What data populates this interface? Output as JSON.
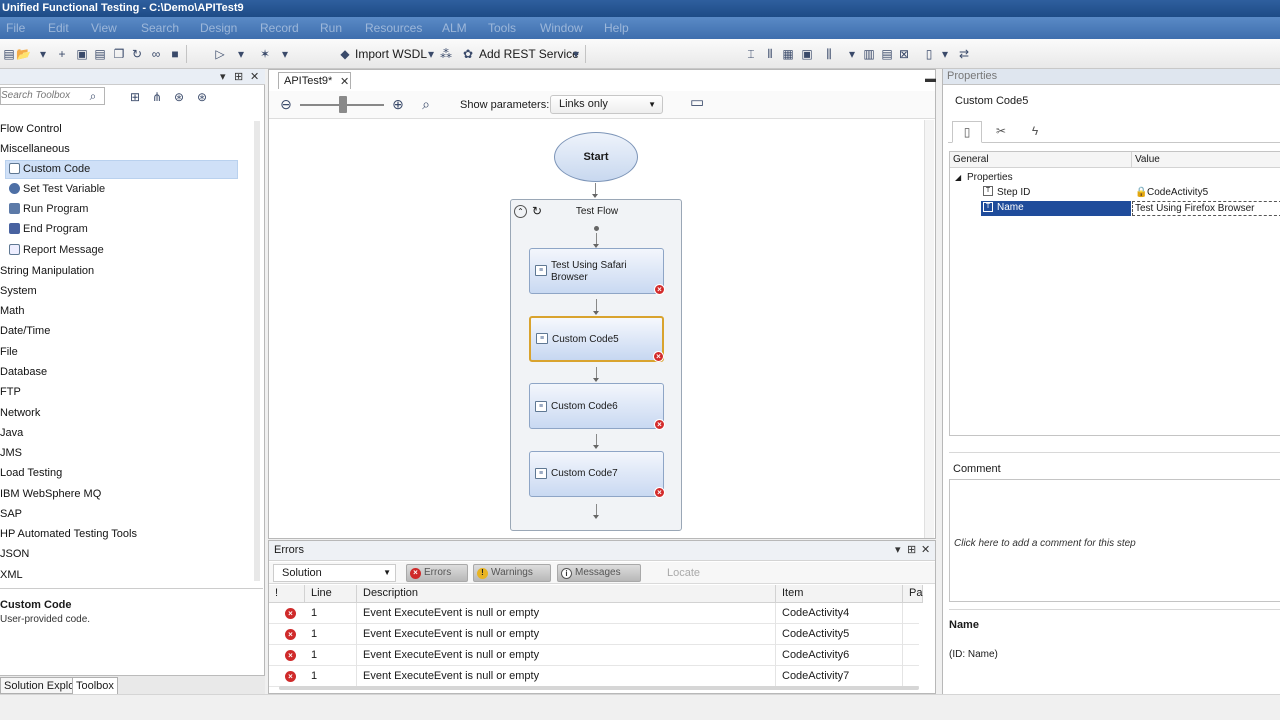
{
  "window": {
    "title": "Unified Functional Testing - C:\\Demo\\APITest9"
  },
  "menu": [
    "File",
    "Edit",
    "View",
    "Search",
    "Design",
    "Record",
    "Run",
    "Resources",
    "ALM",
    "Tools",
    "Window",
    "Help"
  ],
  "toolbar": {
    "import_wsdl": "Import WSDL",
    "add_rest": "Add REST Service"
  },
  "toolbox": {
    "search_placeholder": "Search Toolbox",
    "categories_top": [
      "Flow Control",
      "Miscellaneous"
    ],
    "misc_items": [
      "Custom Code",
      "Set Test Variable",
      "Run Program",
      "End Program",
      "Report Message"
    ],
    "categories_bottom": [
      "String Manipulation",
      "System",
      "Math",
      "Date/Time",
      "File",
      "Database",
      "FTP",
      "Network",
      "Java",
      "JMS",
      "Load Testing",
      "IBM WebSphere MQ",
      "SAP",
      "HP Automated Testing Tools",
      "JSON",
      "XML"
    ],
    "desc_title": "Custom Code",
    "desc_text": "User-provided code.",
    "tabs": [
      "Solution Explorer",
      "Toolbox"
    ]
  },
  "document": {
    "tab_label": "APITest9*",
    "show_params_label": "Show parameters:",
    "show_params_value": "Links only",
    "start_label": "Start",
    "flow_title": "Test Flow",
    "steps": [
      {
        "label": "Test Using Safari Browser",
        "selected": false
      },
      {
        "label": "Custom Code5",
        "selected": true
      },
      {
        "label": "Custom Code6",
        "selected": false
      },
      {
        "label": "Custom Code7",
        "selected": false
      }
    ]
  },
  "errors": {
    "title": "Errors",
    "scope": "Solution",
    "filters": [
      "Errors",
      "Warnings",
      "Messages"
    ],
    "locate": "Locate",
    "columns": [
      "!",
      "Line",
      "Description",
      "Item",
      "Pa"
    ],
    "rows": [
      {
        "line": "1",
        "description": "Event ExecuteEvent is null or empty",
        "item": "CodeActivity4"
      },
      {
        "line": "1",
        "description": "Event ExecuteEvent is null or empty",
        "item": "CodeActivity5"
      },
      {
        "line": "1",
        "description": "Event ExecuteEvent is null or empty",
        "item": "CodeActivity6"
      },
      {
        "line": "1",
        "description": "Event ExecuteEvent is null or empty",
        "item": "CodeActivity7"
      }
    ]
  },
  "properties": {
    "header": "Properties",
    "title": "Custom Code5",
    "grid_columns": [
      "General",
      "Value"
    ],
    "group": "Properties",
    "rows": [
      {
        "name": "Step ID",
        "value": "CodeActivity5"
      },
      {
        "name": "Name",
        "value": "Test Using Firefox Browser"
      }
    ],
    "comment_label": "Comment",
    "comment_placeholder": "Click here to add a comment for this step",
    "help_title": "Name",
    "help_desc": "(ID: Name)"
  },
  "colors": {
    "selection": "#1f4c9b",
    "error": "#d32b2b",
    "selected_step_border": "#d9a32e"
  }
}
